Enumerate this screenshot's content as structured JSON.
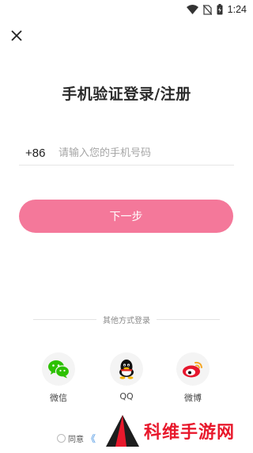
{
  "status_bar": {
    "time": "1:24",
    "icons": [
      "wifi-icon",
      "no-sim-icon",
      "battery-charging-icon"
    ]
  },
  "header": {
    "close_icon": "close-icon"
  },
  "title": "手机验证登录/注册",
  "phone": {
    "country_code": "+86",
    "placeholder": "请输入您的手机号码",
    "value": ""
  },
  "next_button": "下一步",
  "other_login": {
    "label": "其他方式登录",
    "options": [
      {
        "name": "微信",
        "icon": "wechat-icon",
        "color": "#2dc100"
      },
      {
        "name": "QQ",
        "icon": "qq-icon",
        "color": "#000000"
      },
      {
        "name": "微博",
        "icon": "weibo-icon",
        "color": "#e6162d"
      }
    ]
  },
  "agreement": {
    "label": "同意",
    "link": "《"
  },
  "watermark": {
    "text": "科维手游网"
  },
  "colors": {
    "accent": "#f4789a",
    "watermark": "#e8192c"
  }
}
